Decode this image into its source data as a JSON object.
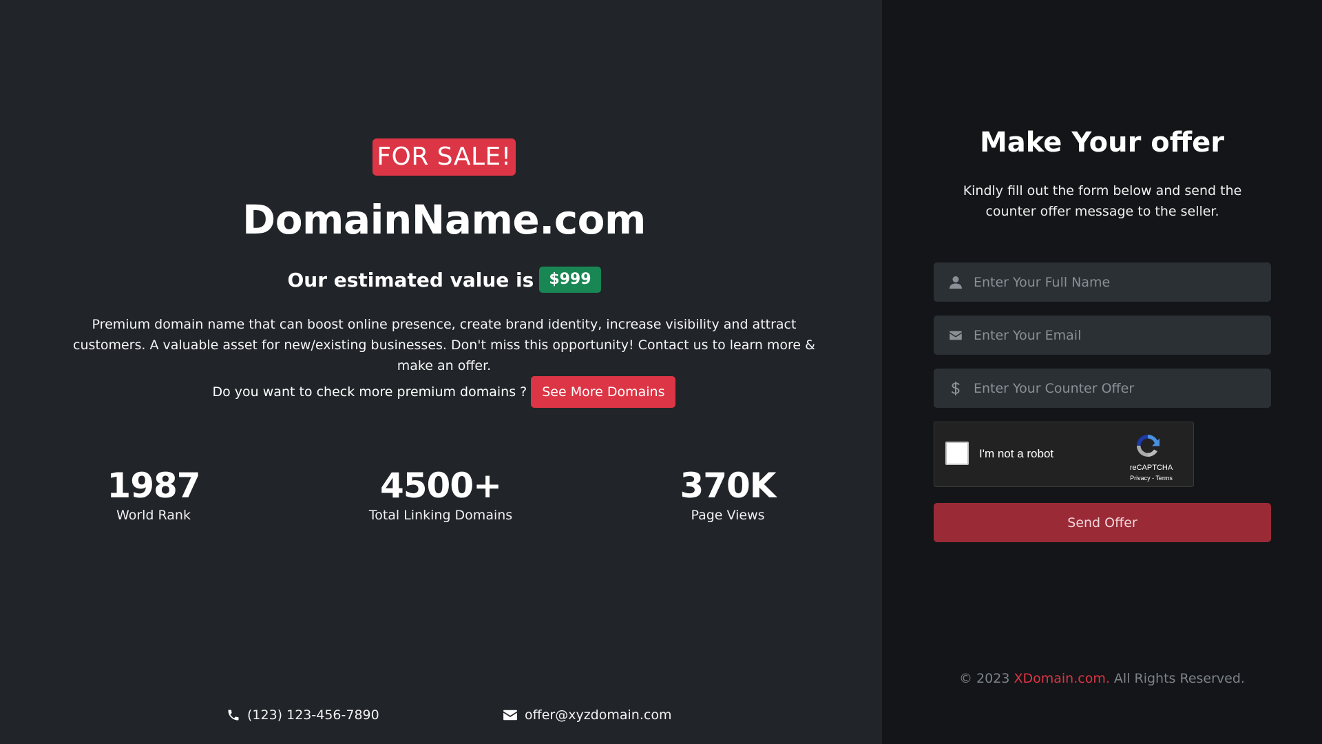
{
  "sale": {
    "badge": "FOR SALE!",
    "domain": "DomainName.com",
    "value_prefix": "Our estimated value is",
    "price": "$999",
    "description": "Premium domain name that can boost online presence, create brand identity, increase visibility and attract customers. A valuable asset for new/existing businesses. Don't miss this opportunity! Contact us to learn more & make an offer.",
    "more_question": "Do you want to check more premium domains ?",
    "more_button": "See More Domains"
  },
  "stats": [
    {
      "value": "1987",
      "label": "World Rank"
    },
    {
      "value": "4500+",
      "label": "Total Linking Domains"
    },
    {
      "value": "370K",
      "label": "Page Views"
    }
  ],
  "contact": {
    "phone": "(123) 123-456-7890",
    "email": "offer@xyzdomain.com"
  },
  "offer": {
    "title": "Make Your offer",
    "subtitle": "Kindly fill out the form below and send the counter offer message to the seller.",
    "name_placeholder": "Enter Your Full Name",
    "email_placeholder": "Enter Your Email",
    "counter_placeholder": "Enter Your Counter Offer",
    "send_button": "Send Offer"
  },
  "recaptcha": {
    "label": "I'm not a robot",
    "brand": "reCAPTCHA",
    "links": "Privacy - Terms"
  },
  "footer": {
    "prefix": "© 2023",
    "brand": "XDomain.com.",
    "suffix": "All Rights Reserved."
  },
  "colors": {
    "accent_red": "#dc3545",
    "price_green": "#198754",
    "left_bg": "#212429",
    "right_bg": "#131518"
  }
}
